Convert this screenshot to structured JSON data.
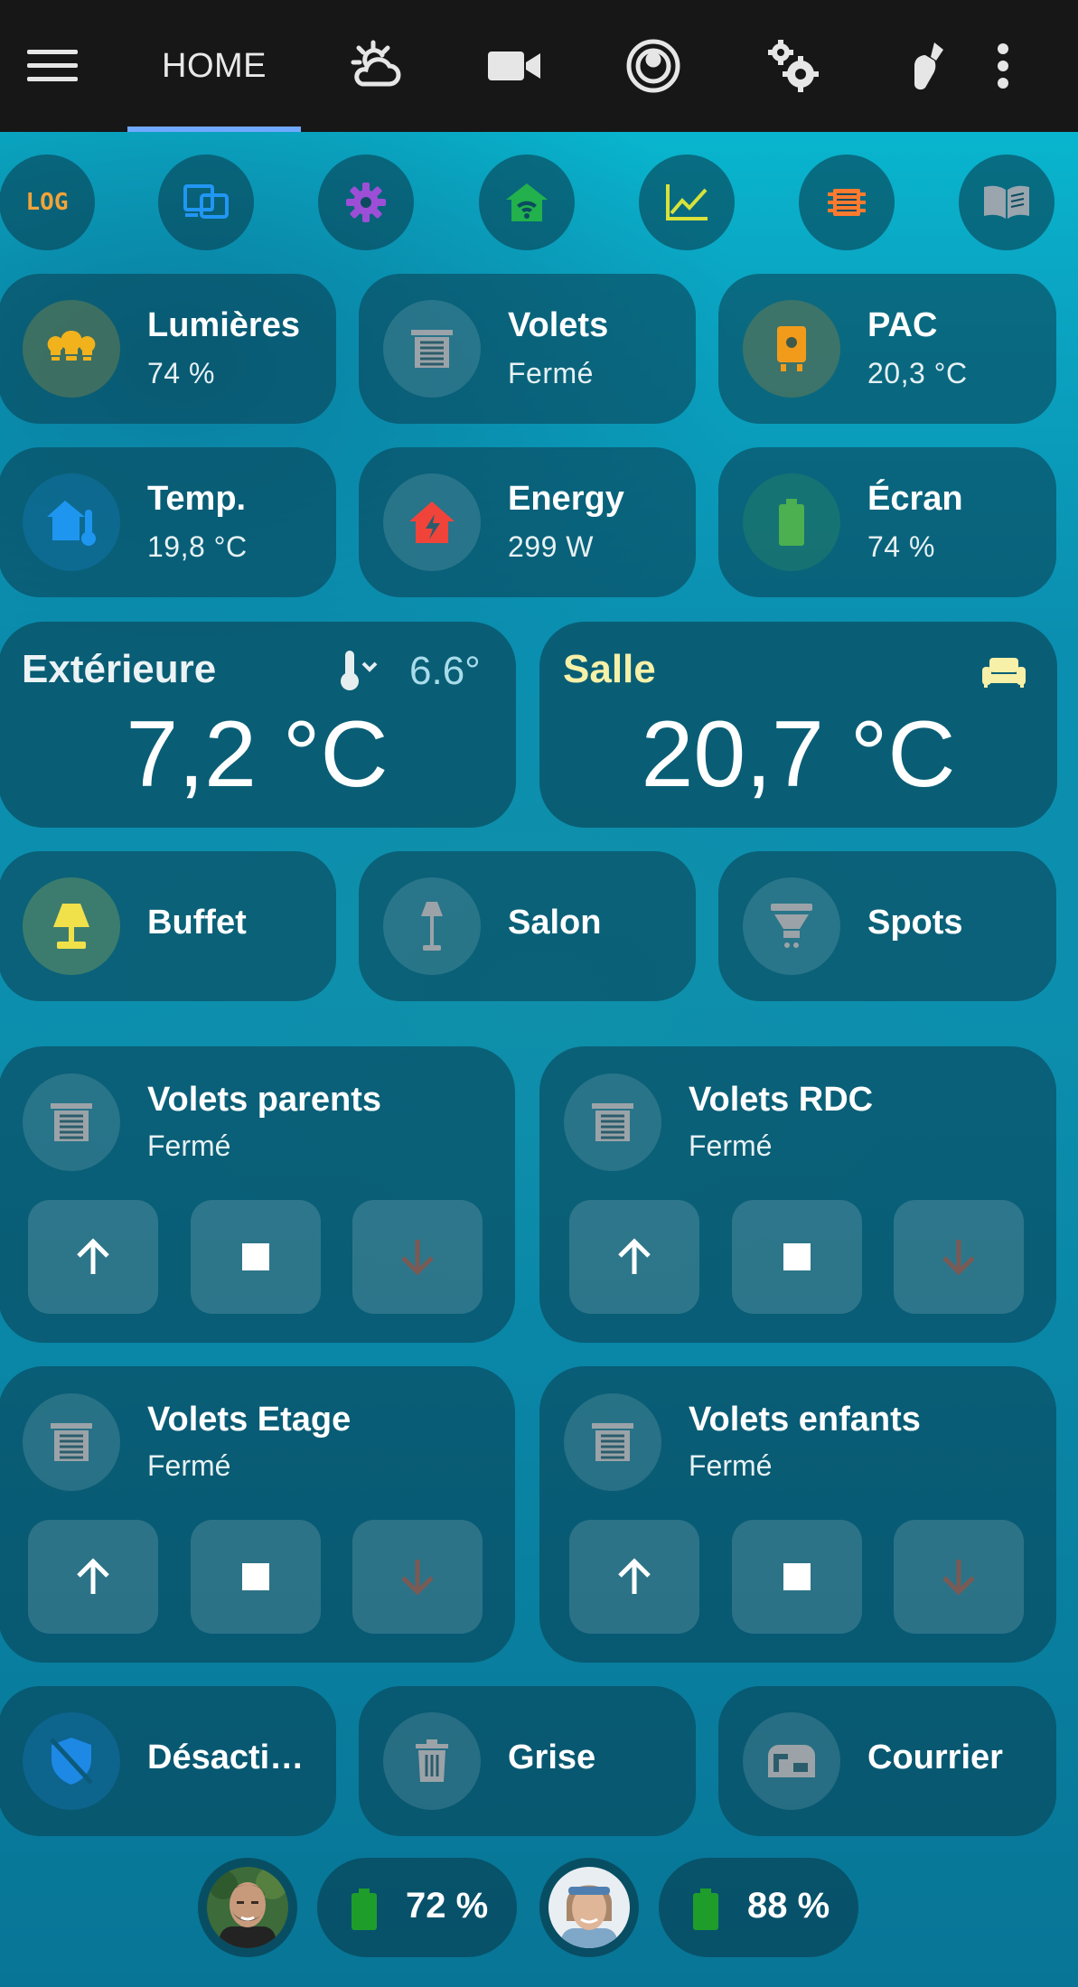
{
  "topbar": {
    "home_label": "HOME",
    "icons": [
      "menu-icon",
      "weather-partly-cloudy-icon",
      "camera-icon",
      "robot-vacuum-icon",
      "cogs-icon",
      "watering-can-icon",
      "more-vertical-icon"
    ]
  },
  "quick_buttons": [
    {
      "icon": "log-icon",
      "label": "LOG",
      "color": "#f2a33a"
    },
    {
      "icon": "devices-icon",
      "color": "#2196f3"
    },
    {
      "icon": "settings-icon",
      "color": "#9c4fd6"
    },
    {
      "icon": "home-wifi-icon",
      "color": "#22b14c"
    },
    {
      "icon": "chart-line-icon",
      "color": "#d8e23a"
    },
    {
      "icon": "chip-icon",
      "color": "#ff7a2f"
    },
    {
      "icon": "book-open-icon",
      "color": "#9aa5ad"
    }
  ],
  "summary_tiles": [
    {
      "name": "Lumières",
      "state": "74 %",
      "icon": "lightbulb-group-icon",
      "color": "#f2b21b"
    },
    {
      "name": "Volets",
      "state": "Fermé",
      "icon": "window-shutter-icon",
      "color": "#9ba3a8"
    },
    {
      "name": "PAC",
      "state": "20,3 °C",
      "icon": "heat-pump-icon",
      "color": "#f29b1b"
    },
    {
      "name": "Temp.",
      "state": "19,8 °C",
      "icon": "home-thermometer-icon",
      "color": "#1e96f0"
    },
    {
      "name": "Energy",
      "state": "299 W",
      "icon": "home-lightning-icon",
      "color": "#f0443a"
    },
    {
      "name": "Écran",
      "state": "74 %",
      "icon": "battery-icon",
      "color": "#4caf50"
    }
  ],
  "temperature_cards": [
    {
      "title": "Extérieure",
      "value": "7,2 °C",
      "sub_value": "6.6°",
      "icon": "thermometer-chevron-down-icon",
      "title_color": "#ecf3f5"
    },
    {
      "title": "Salle",
      "value": "20,7 °C",
      "icon": "sofa-icon",
      "title_color": "#f6f0a8"
    }
  ],
  "light_tiles": [
    {
      "name": "Buffet",
      "icon": "lamp-icon",
      "color": "#f0e04a"
    },
    {
      "name": "Salon",
      "icon": "floor-lamp-icon",
      "color": "#9ba3a8"
    },
    {
      "name": "Spots",
      "icon": "ceiling-light-icon",
      "color": "#9ba3a8"
    }
  ],
  "covers": [
    {
      "name": "Volets parents",
      "state": "Fermé"
    },
    {
      "name": "Volets RDC",
      "state": "Fermé"
    },
    {
      "name": "Volets Etage",
      "state": "Fermé"
    },
    {
      "name": "Volets enfants",
      "state": "Fermé"
    }
  ],
  "bottom_tiles": [
    {
      "name": "Désacti…",
      "icon": "shield-off-icon",
      "color": "#1e88e5"
    },
    {
      "name": "Grise",
      "icon": "trash-can-icon",
      "color": "#9ba3a8"
    },
    {
      "name": "Courrier",
      "icon": "mailbox-icon",
      "color": "#9ba3a8"
    }
  ],
  "persons": [
    {
      "avatar": "person-avatar-man",
      "battery": "72 %"
    },
    {
      "avatar": "person-avatar-woman",
      "battery": "88 %"
    }
  ],
  "colors": {
    "battery": "#1f9d2b",
    "arrow_disabled": "#7a5a55"
  }
}
